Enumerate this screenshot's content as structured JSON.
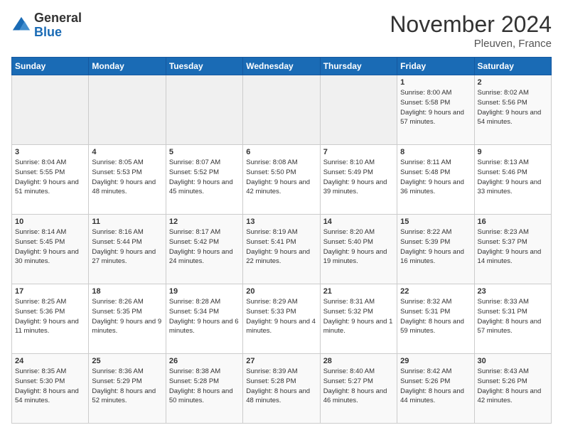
{
  "logo": {
    "general": "General",
    "blue": "Blue"
  },
  "header": {
    "month": "November 2024",
    "location": "Pleuven, France"
  },
  "weekdays": [
    "Sunday",
    "Monday",
    "Tuesday",
    "Wednesday",
    "Thursday",
    "Friday",
    "Saturday"
  ],
  "weeks": [
    [
      {
        "day": "",
        "sunrise": "",
        "sunset": "",
        "daylight": "",
        "empty": true
      },
      {
        "day": "",
        "sunrise": "",
        "sunset": "",
        "daylight": "",
        "empty": true
      },
      {
        "day": "",
        "sunrise": "",
        "sunset": "",
        "daylight": "",
        "empty": true
      },
      {
        "day": "",
        "sunrise": "",
        "sunset": "",
        "daylight": "",
        "empty": true
      },
      {
        "day": "",
        "sunrise": "",
        "sunset": "",
        "daylight": "",
        "empty": true
      },
      {
        "day": "1",
        "sunrise": "Sunrise: 8:00 AM",
        "sunset": "Sunset: 5:58 PM",
        "daylight": "Daylight: 9 hours and 57 minutes.",
        "empty": false
      },
      {
        "day": "2",
        "sunrise": "Sunrise: 8:02 AM",
        "sunset": "Sunset: 5:56 PM",
        "daylight": "Daylight: 9 hours and 54 minutes.",
        "empty": false
      }
    ],
    [
      {
        "day": "3",
        "sunrise": "Sunrise: 8:04 AM",
        "sunset": "Sunset: 5:55 PM",
        "daylight": "Daylight: 9 hours and 51 minutes.",
        "empty": false
      },
      {
        "day": "4",
        "sunrise": "Sunrise: 8:05 AM",
        "sunset": "Sunset: 5:53 PM",
        "daylight": "Daylight: 9 hours and 48 minutes.",
        "empty": false
      },
      {
        "day": "5",
        "sunrise": "Sunrise: 8:07 AM",
        "sunset": "Sunset: 5:52 PM",
        "daylight": "Daylight: 9 hours and 45 minutes.",
        "empty": false
      },
      {
        "day": "6",
        "sunrise": "Sunrise: 8:08 AM",
        "sunset": "Sunset: 5:50 PM",
        "daylight": "Daylight: 9 hours and 42 minutes.",
        "empty": false
      },
      {
        "day": "7",
        "sunrise": "Sunrise: 8:10 AM",
        "sunset": "Sunset: 5:49 PM",
        "daylight": "Daylight: 9 hours and 39 minutes.",
        "empty": false
      },
      {
        "day": "8",
        "sunrise": "Sunrise: 8:11 AM",
        "sunset": "Sunset: 5:48 PM",
        "daylight": "Daylight: 9 hours and 36 minutes.",
        "empty": false
      },
      {
        "day": "9",
        "sunrise": "Sunrise: 8:13 AM",
        "sunset": "Sunset: 5:46 PM",
        "daylight": "Daylight: 9 hours and 33 minutes.",
        "empty": false
      }
    ],
    [
      {
        "day": "10",
        "sunrise": "Sunrise: 8:14 AM",
        "sunset": "Sunset: 5:45 PM",
        "daylight": "Daylight: 9 hours and 30 minutes.",
        "empty": false
      },
      {
        "day": "11",
        "sunrise": "Sunrise: 8:16 AM",
        "sunset": "Sunset: 5:44 PM",
        "daylight": "Daylight: 9 hours and 27 minutes.",
        "empty": false
      },
      {
        "day": "12",
        "sunrise": "Sunrise: 8:17 AM",
        "sunset": "Sunset: 5:42 PM",
        "daylight": "Daylight: 9 hours and 24 minutes.",
        "empty": false
      },
      {
        "day": "13",
        "sunrise": "Sunrise: 8:19 AM",
        "sunset": "Sunset: 5:41 PM",
        "daylight": "Daylight: 9 hours and 22 minutes.",
        "empty": false
      },
      {
        "day": "14",
        "sunrise": "Sunrise: 8:20 AM",
        "sunset": "Sunset: 5:40 PM",
        "daylight": "Daylight: 9 hours and 19 minutes.",
        "empty": false
      },
      {
        "day": "15",
        "sunrise": "Sunrise: 8:22 AM",
        "sunset": "Sunset: 5:39 PM",
        "daylight": "Daylight: 9 hours and 16 minutes.",
        "empty": false
      },
      {
        "day": "16",
        "sunrise": "Sunrise: 8:23 AM",
        "sunset": "Sunset: 5:37 PM",
        "daylight": "Daylight: 9 hours and 14 minutes.",
        "empty": false
      }
    ],
    [
      {
        "day": "17",
        "sunrise": "Sunrise: 8:25 AM",
        "sunset": "Sunset: 5:36 PM",
        "daylight": "Daylight: 9 hours and 11 minutes.",
        "empty": false
      },
      {
        "day": "18",
        "sunrise": "Sunrise: 8:26 AM",
        "sunset": "Sunset: 5:35 PM",
        "daylight": "Daylight: 9 hours and 9 minutes.",
        "empty": false
      },
      {
        "day": "19",
        "sunrise": "Sunrise: 8:28 AM",
        "sunset": "Sunset: 5:34 PM",
        "daylight": "Daylight: 9 hours and 6 minutes.",
        "empty": false
      },
      {
        "day": "20",
        "sunrise": "Sunrise: 8:29 AM",
        "sunset": "Sunset: 5:33 PM",
        "daylight": "Daylight: 9 hours and 4 minutes.",
        "empty": false
      },
      {
        "day": "21",
        "sunrise": "Sunrise: 8:31 AM",
        "sunset": "Sunset: 5:32 PM",
        "daylight": "Daylight: 9 hours and 1 minute.",
        "empty": false
      },
      {
        "day": "22",
        "sunrise": "Sunrise: 8:32 AM",
        "sunset": "Sunset: 5:31 PM",
        "daylight": "Daylight: 8 hours and 59 minutes.",
        "empty": false
      },
      {
        "day": "23",
        "sunrise": "Sunrise: 8:33 AM",
        "sunset": "Sunset: 5:31 PM",
        "daylight": "Daylight: 8 hours and 57 minutes.",
        "empty": false
      }
    ],
    [
      {
        "day": "24",
        "sunrise": "Sunrise: 8:35 AM",
        "sunset": "Sunset: 5:30 PM",
        "daylight": "Daylight: 8 hours and 54 minutes.",
        "empty": false
      },
      {
        "day": "25",
        "sunrise": "Sunrise: 8:36 AM",
        "sunset": "Sunset: 5:29 PM",
        "daylight": "Daylight: 8 hours and 52 minutes.",
        "empty": false
      },
      {
        "day": "26",
        "sunrise": "Sunrise: 8:38 AM",
        "sunset": "Sunset: 5:28 PM",
        "daylight": "Daylight: 8 hours and 50 minutes.",
        "empty": false
      },
      {
        "day": "27",
        "sunrise": "Sunrise: 8:39 AM",
        "sunset": "Sunset: 5:28 PM",
        "daylight": "Daylight: 8 hours and 48 minutes.",
        "empty": false
      },
      {
        "day": "28",
        "sunrise": "Sunrise: 8:40 AM",
        "sunset": "Sunset: 5:27 PM",
        "daylight": "Daylight: 8 hours and 46 minutes.",
        "empty": false
      },
      {
        "day": "29",
        "sunrise": "Sunrise: 8:42 AM",
        "sunset": "Sunset: 5:26 PM",
        "daylight": "Daylight: 8 hours and 44 minutes.",
        "empty": false
      },
      {
        "day": "30",
        "sunrise": "Sunrise: 8:43 AM",
        "sunset": "Sunset: 5:26 PM",
        "daylight": "Daylight: 8 hours and 42 minutes.",
        "empty": false
      }
    ]
  ]
}
